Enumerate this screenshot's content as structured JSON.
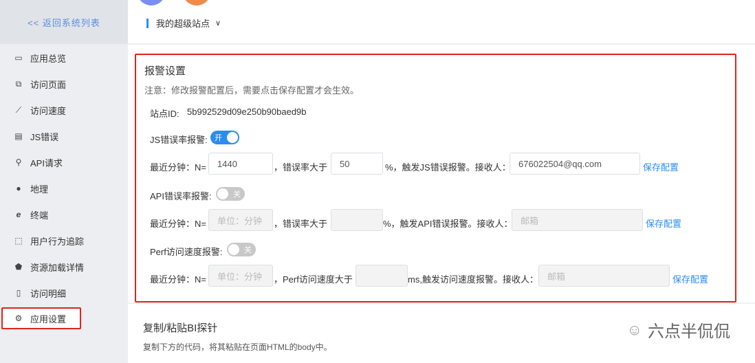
{
  "sidebar": {
    "back": "<< 返回系统列表",
    "items": [
      {
        "label": "应用总览",
        "icon": "laptop-icon"
      },
      {
        "label": "访问页面",
        "icon": "pages-icon"
      },
      {
        "label": "访问速度",
        "icon": "line-chart-icon"
      },
      {
        "label": "JS错误",
        "icon": "bug-file-icon"
      },
      {
        "label": "API请求",
        "icon": "link-icon"
      },
      {
        "label": "地理",
        "icon": "globe-icon"
      },
      {
        "label": "终端",
        "icon": "ie-icon"
      },
      {
        "label": "用户行为追踪",
        "icon": "track-icon"
      },
      {
        "label": "资源加载详情",
        "icon": "resource-icon"
      },
      {
        "label": "访问明细",
        "icon": "file-icon"
      },
      {
        "label": "应用设置",
        "icon": "gear-icon"
      }
    ]
  },
  "header": {
    "site": "我的超级站点"
  },
  "alarm": {
    "title": "报警设置",
    "note": "注意：修改报警配置后，需要点击保存配置才会生效。",
    "site_id_label": "站点ID:",
    "site_id": "5b992529d09e250b90baed9b",
    "js": {
      "label": "JS错误率报警:",
      "switch": "开",
      "n_label": "最近分钟：N=",
      "n": "1440",
      "rate_label": "，错误率大于",
      "rate": "50",
      "trigger": "%，触发JS错误报警。接收人：",
      "email": "676022504@qq.com",
      "save": "保存配置"
    },
    "api": {
      "label": "API错误率报警:",
      "switch": "关",
      "n_label": "最近分钟：N=",
      "n_placeholder": "单位：分钟",
      "rate_label": "，错误率大于",
      "trigger": "%，触发API错误报警。接收人：",
      "email_placeholder": "邮箱",
      "save": "保存配置"
    },
    "perf": {
      "label": "Perf访问速度报警:",
      "switch": "关",
      "n_label": "最近分钟：N=",
      "n_placeholder": "单位：分钟",
      "rate_label": "，Perf访问速度大于",
      "trigger": "ms,触发访问速度报警。接收人：",
      "email_placeholder": "邮箱",
      "save": "保存配置"
    }
  },
  "probe": {
    "title": "复制/粘贴BI探针",
    "desc": "复制下方的代码，将其粘贴在页面HTML的body中。"
  },
  "watermark": "六点半侃侃"
}
